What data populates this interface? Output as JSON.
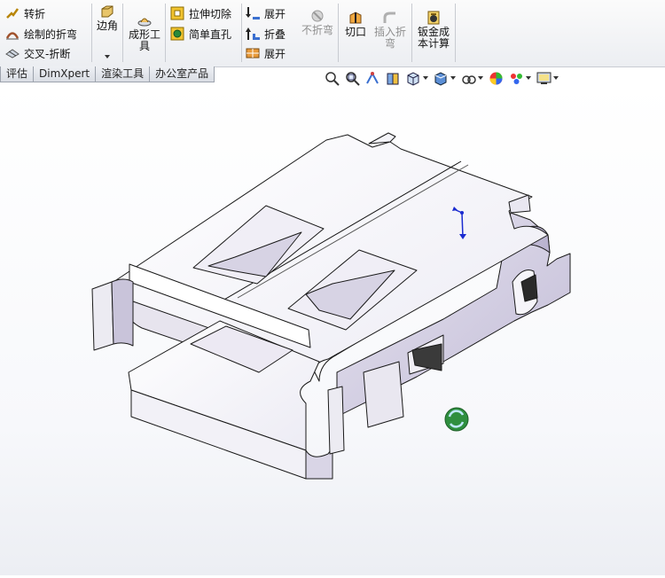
{
  "ribbon": {
    "sheetmetal_group": {
      "jog": "转折",
      "sketched_bend": "绘制的折弯",
      "cross_break": "交叉-折断"
    },
    "corners": "边角",
    "forming_tool": "成形工具",
    "extruded_cut": "拉伸切除",
    "simple_hole": "简单直孔",
    "unfold": "展开",
    "fold": "折叠",
    "flatten": "展开",
    "no_bends": "不折弯",
    "rip": "切口",
    "insert_bends": "插入折弯",
    "sheetmetal_costing": "钣金成本计算"
  },
  "tabs": [
    "评估",
    "DimXpert",
    "渲染工具",
    "办公室产品"
  ],
  "view_toolbar_icons": [
    "zoom-to-fit-icon",
    "zoom-area-icon",
    "previous-view-icon",
    "section-view-icon",
    "view-orientation-icon",
    "display-style-icon",
    "hide-show-items-icon",
    "edit-appearance-icon",
    "apply-scene-icon",
    "view-settings-icon"
  ],
  "colors": {
    "part_face": "#f4f4fa",
    "part_shade": "#bfb9d4",
    "edge": "#1a1a1a"
  }
}
